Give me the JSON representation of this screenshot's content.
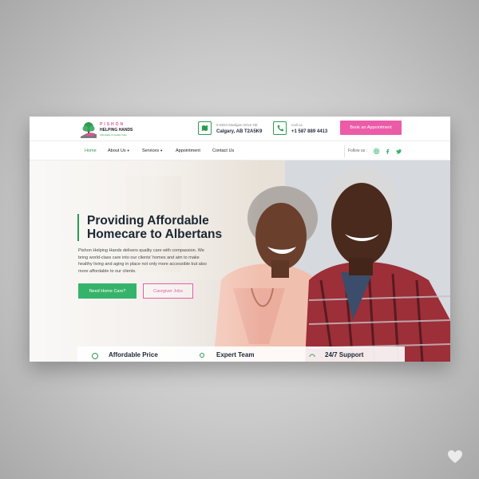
{
  "brand": {
    "name_line1": "PISHON",
    "name_line2": "HELPING HANDS",
    "tagline": "Affordable & Quality Care"
  },
  "contact": {
    "address_line1": "5-6923 Madigan Drive NE",
    "address_line2": "Calgary, AB T2A5K9",
    "call_label": "Call us",
    "phone": "+1 587 889 4413"
  },
  "header": {
    "book_label": "Book an Appointment"
  },
  "nav": {
    "items": [
      {
        "label": "Home",
        "caret": ""
      },
      {
        "label": "About Us",
        "caret": "▼"
      },
      {
        "label": "Services",
        "caret": "▼"
      },
      {
        "label": "Appointment",
        "caret": ""
      },
      {
        "label": "Contact Us",
        "caret": ""
      }
    ],
    "follow_label": "Follow us :",
    "social": [
      "instagram-icon",
      "facebook-icon",
      "twitter-icon"
    ]
  },
  "hero": {
    "title": "Providing Affordable Homecare to Albertans",
    "description": "Pishon Helping Hands delivers quality care with compassion. We bring world-class care into our clients’ homes and aim to make healthy living and aging in place not only more accessible but also more affordable to our clients.",
    "primary_button": "Need Home Care?",
    "secondary_button": "Caregiver Jobs"
  },
  "features": [
    {
      "title": "Affordable Price",
      "icon": "coins-icon"
    },
    {
      "title": "Expert Team",
      "icon": "team-icon"
    },
    {
      "title": "24/7 Support",
      "icon": "support-icon"
    }
  ],
  "colors": {
    "accent_green": "#2e9a52",
    "accent_pink": "#ec5ba8",
    "button_green": "#36b36a",
    "heading": "#1b2733"
  }
}
